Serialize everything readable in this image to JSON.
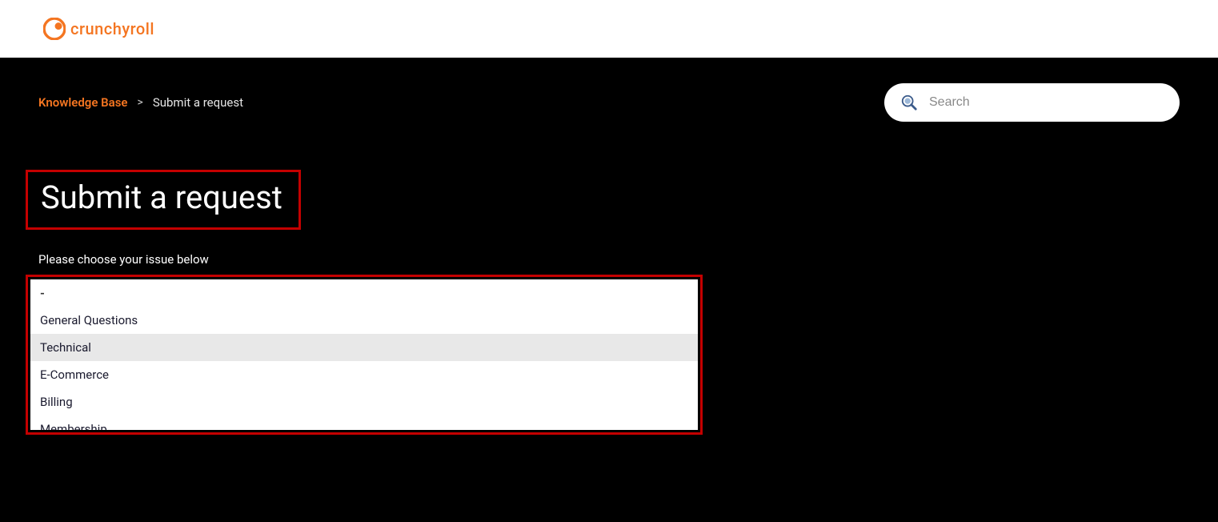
{
  "brand": {
    "name": "crunchyroll"
  },
  "breadcrumb": {
    "link_label": "Knowledge Base",
    "separator": ">",
    "current": "Submit a request"
  },
  "search": {
    "placeholder": "Search"
  },
  "page": {
    "title": "Submit a request",
    "form_label": "Please choose your issue below"
  },
  "dropdown": {
    "options": [
      {
        "label": "-",
        "highlighted": false,
        "blank": true
      },
      {
        "label": "General Questions",
        "highlighted": false,
        "blank": false
      },
      {
        "label": "Technical",
        "highlighted": true,
        "blank": false
      },
      {
        "label": "E-Commerce",
        "highlighted": false,
        "blank": false
      },
      {
        "label": "Billing",
        "highlighted": false,
        "blank": false
      },
      {
        "label": "Membership",
        "highlighted": false,
        "blank": false
      }
    ]
  },
  "colors": {
    "brand_orange": "#f47521",
    "highlight_red": "#c40000"
  }
}
